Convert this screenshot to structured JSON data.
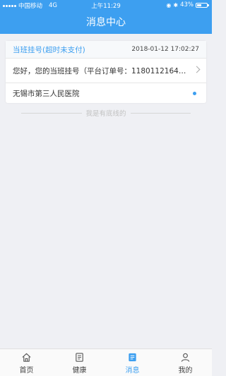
{
  "status_bar": {
    "carrier": "中国移动",
    "network": "4G",
    "time": "上午11:29",
    "battery_text": "43%",
    "battery_level": 0.43
  },
  "nav": {
    "title": "消息中心"
  },
  "message": {
    "title": "当班挂号(超时未支付)",
    "date": "2018-01-12 17:02:27",
    "content": "您好，您的当班挂号（平台订单号：1180112164837...",
    "hospital": "无锡市第三人民医院"
  },
  "footer_text": "我是有底线的",
  "tabs": [
    {
      "label": "首页",
      "icon": "home-icon",
      "active": false
    },
    {
      "label": "健康",
      "icon": "health-book-icon",
      "active": false
    },
    {
      "label": "消息",
      "icon": "message-icon",
      "active": true
    },
    {
      "label": "我的",
      "icon": "person-icon",
      "active": false
    }
  ],
  "colors": {
    "accent": "#3d9ff0",
    "background": "#eff0f4"
  }
}
